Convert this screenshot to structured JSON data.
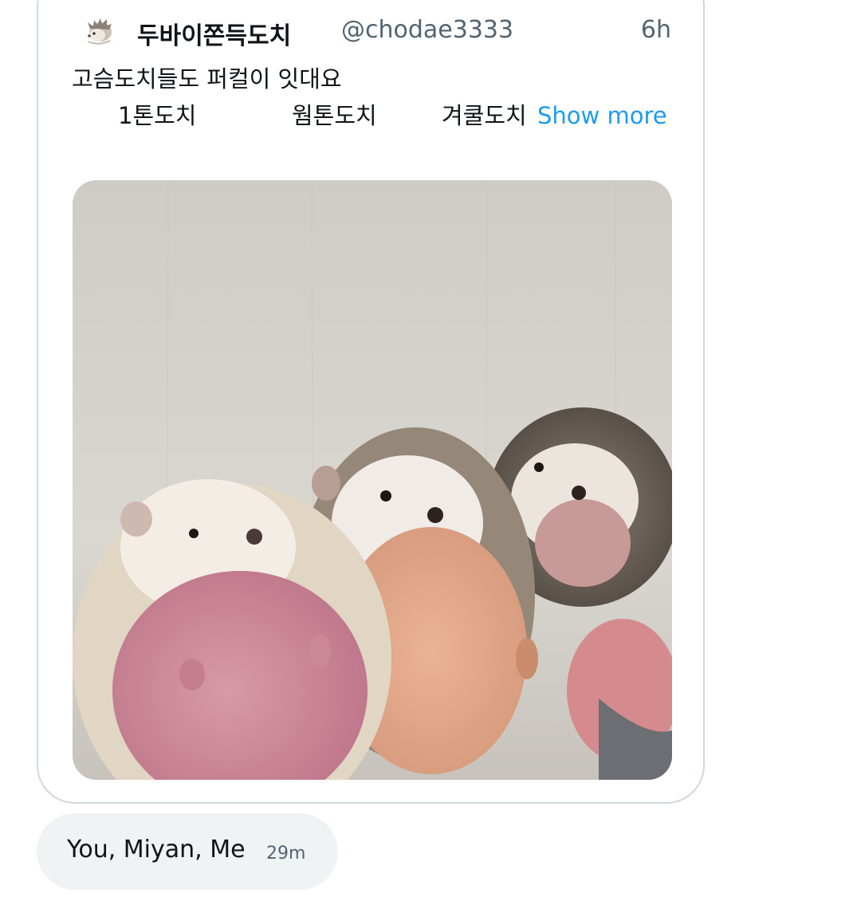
{
  "quoted_tweet": {
    "display_name": "두바이쫀득도치",
    "handle": "@chodae3333",
    "time": "6h",
    "text_line1": "고슴도치들도 퍼컬이 잇대요",
    "text_line2": {
      "item1": "1톤도치",
      "item2": "웜톤도치",
      "item3": "겨쿨도치",
      "show_more": "Show more"
    },
    "media_icon": "three-hedgehogs-photo",
    "avatar_icon": "hedgehog-avatar-icon"
  },
  "reaction": {
    "text": "You, Miyan, Me",
    "time": "29m"
  },
  "colors": {
    "link": "#1d9bf0",
    "secondary_text": "#536471",
    "card_border": "#cfd9de",
    "bubble_bg": "#eff3f4"
  }
}
